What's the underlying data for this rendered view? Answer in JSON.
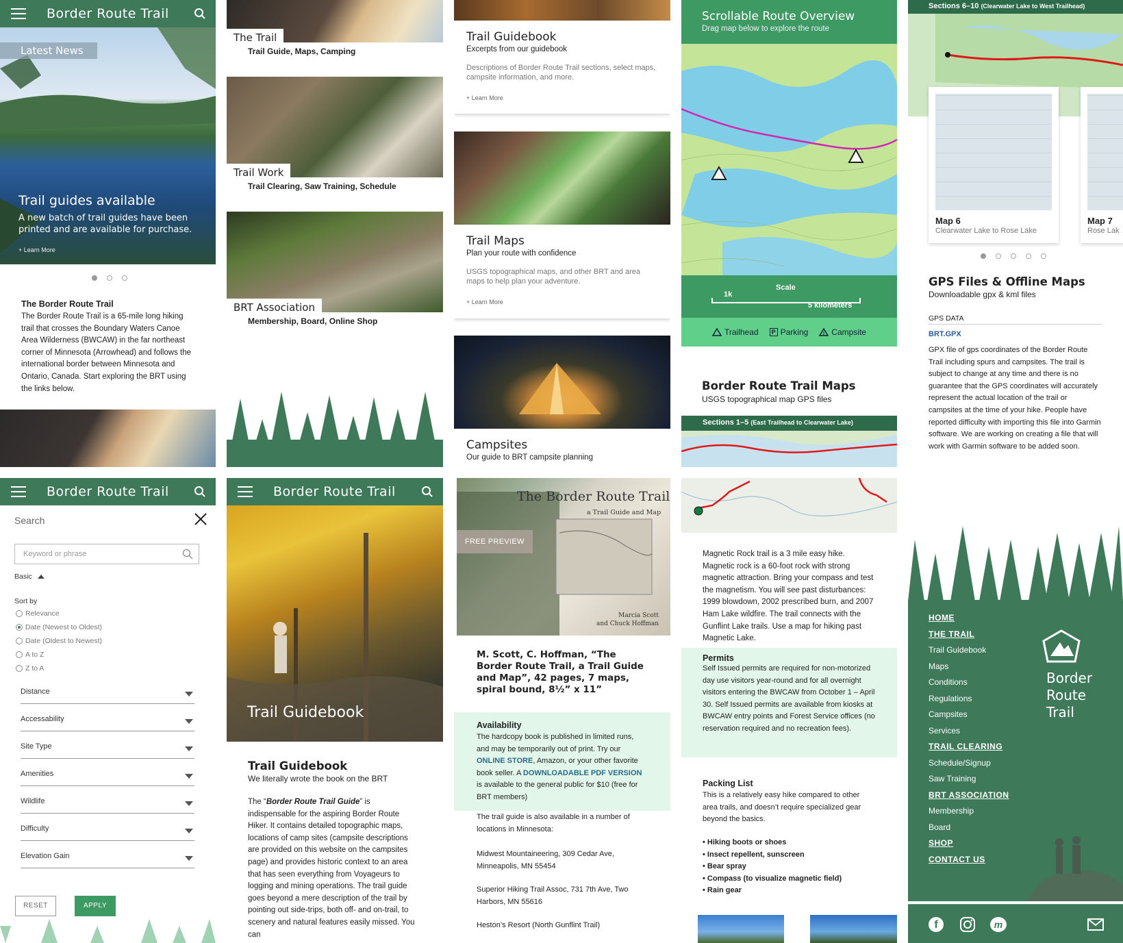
{
  "app": {
    "title": "Border Route Trail"
  },
  "home": {
    "news_label": "Latest News",
    "hero_title": "Trail guides available",
    "hero_text": "A new batch of trail guides have been printed and are available for purchase.",
    "hero_more": "+ Learn More",
    "intro_title": "The Border Route Trail",
    "intro_text": "The Border Route Trail is a 65-mile long hiking trail that crosses the Boundary Waters Canoe Area Wilderness (BWCAW) in the far northeast corner of Minnesota (Arrowhead) and follows the international border between Minnesota and Ontario, Canada. Start exploring the BRT using the links below."
  },
  "sections": [
    {
      "title": "The Trail",
      "subtitle": "Trail Guide, Maps, Camping"
    },
    {
      "title": "Trail Work",
      "subtitle": "Trail Clearing, Saw Training, Schedule"
    },
    {
      "title": "BRT Association",
      "subtitle": "Membership, Board, Online Shop"
    }
  ],
  "cards": {
    "guidebook": {
      "title": "Trail Guidebook",
      "subtitle": "Excerpts from our guidebook",
      "desc": "Descriptions of Border Route Trail sections, select maps, campsite information, and more.",
      "more": "+ Learn More"
    },
    "maps": {
      "title": "Trail Maps",
      "subtitle": "Plan your route with confidence",
      "desc": "USGS topographical maps, and other BRT and area maps to help plan your adventure.",
      "more": "+ Learn More"
    },
    "campsites": {
      "title": "Campsites",
      "subtitle": "Our guide to BRT campsite planning"
    }
  },
  "overview": {
    "title": "Scrollable Route Overview",
    "subtitle": "Drag map below to explore the route",
    "scale_label": "Scale",
    "scale_1k": "1k",
    "scale_5k": "5 kilometers",
    "legend": {
      "trailhead": "Trailhead",
      "parking": "Parking",
      "campsite": "Campsite"
    },
    "maps_title": "Border Route Trail Maps",
    "maps_subtitle": "USGS topographical map GPS files",
    "sections_label": "Sections 1–5",
    "sections_detail": "(East Trailhead to Clearwater Lake)"
  },
  "gps": {
    "sections_label": "Sections 6–10",
    "sections_detail": "(Clearwater Lake to West Trailhead)",
    "map_a_title": "Map 6",
    "map_a_sub": "Clearwater Lake to Rose Lake",
    "map_b_title": "Map 7",
    "map_b_sub": "Rose Lak",
    "title": "GPS Files & Offline Maps",
    "subtitle": "Downloadable gpx & kml files",
    "data_label": "GPS DATA",
    "file": "BRT.GPX",
    "desc": "GPX file of gps coordinates of the Border Route Trail including spurs and campsites. The trail is subject to change at any time and there is no guarantee that the GPS coordinates will accurately represent the actual location of the trail or campsites at the time of your hike. People have reported difficulty with importing this file into Garmin software. We are working on creating a file that will work with Garmin software to be added soon."
  },
  "search": {
    "label": "Search",
    "placeholder": "Keyword or phrase",
    "basic": "Basic",
    "sort_by": "Sort by",
    "options": [
      "Relevance",
      "Date (Newest to Oldest)",
      "Date (Oldest to Newest)",
      "A to Z",
      "Z to A"
    ],
    "filters": [
      "Distance",
      "Accessability",
      "Site Type",
      "Amenities",
      "Wildlife",
      "Difficulty",
      "Elevation Gain"
    ],
    "reset": "RESET",
    "apply": "APPLY"
  },
  "guidebook_page": {
    "hero": "Trail Guidebook",
    "title": "Trail Guidebook",
    "subtitle": "We literally wrote the book on the BRT",
    "text_a": "The “",
    "text_em": "Border Route Trail Guide",
    "text_b": "” is indispensable for the aspiring Border Route Hiker. It contains detailed topographic maps, locations of camp sites (campsite descriptions are provided on this website on the campsites page) and provides historic context to an area that has seen everything from Voyageurs to logging and mining operations. The trail guide goes beyond a mere description of the trail by pointing out side-trips, both off- and on-trail, to scenery and natural features easily missed. You can"
  },
  "book": {
    "cover_title": "The Border Route Trail",
    "cover_sub": "a Trail Guide and Map",
    "cover_authors_1": "Marcia Scott",
    "cover_authors_2": "and Chuck Hoffman",
    "preview": "FREE PREVIEW",
    "citation": "M. Scott, C. Hoffman, “The Border Route Trail, a Trail Guide and Map”, 42 pages, 7 maps, spiral bound, 8½” x 11”",
    "avail_title": "Availability",
    "avail_1": "The hardcopy book is published in limited runs, and may be temporarily out of print. Try our ",
    "avail_link1": "ONLINE STORE",
    "avail_2": ", Amazon, or your other favorite book seller. A ",
    "avail_link2": "DOWNLOADABLE PDF VERSION",
    "avail_3": " is available to the general public for $10 (free for BRT members)",
    "locations_intro": "The trail guide is also available in a number of locations in Minnesota:",
    "locations": [
      "Midwest Mountaineering, 309 Cedar Ave, Minneapolis, MN 55454",
      "Superior Hiking Trail Assoc, 731 7th Ave, Two Harbors, MN 55616",
      "Heston’s Resort (North Gunflint Trail)"
    ]
  },
  "magnetic": {
    "desc": "Magnetic Rock trail is a 3 mile easy hike. Magnetic rock is a 60-foot rock with strong magnetic attraction. Bring your compass and test the magnetism. You will see past disturbances: 1999 blowdown, 2002 prescribed burn, and 2007 Ham Lake wildfire. The trail connects with the Gunflint Lake trails. Use a map for hiking past Magnetic Lake.",
    "permits_title": "Permits",
    "permits": "Self Issued permits are required for non-motorized day use visitors year-round and for all overnight visitors entering the BWCAW from October 1 – April 30. Self Issued permits are available from kiosks at BWCAW entry points and Forest Service offices (no reservation required and no recreation fees).",
    "packing_title": "Packing List",
    "packing": "This is a relatively easy hike compared to other area trails, and doesn’t require specialized gear beyond the basics.",
    "items": [
      "• Hiking boots or shoes",
      "• Insect repellent, sunscreen",
      "• Bear spray",
      "• Compass (to visualize magnetic field)",
      "• Rain gear"
    ]
  },
  "footer": {
    "nav": [
      {
        "label": "HOME",
        "heading": true
      },
      {
        "label": "THE TRAIL",
        "heading": true
      },
      {
        "label": "Trail Guidebook"
      },
      {
        "label": "Maps"
      },
      {
        "label": "Conditions"
      },
      {
        "label": "Regulations"
      },
      {
        "label": "Campsites"
      },
      {
        "label": "Services"
      },
      {
        "label": "TRAIL CLEARING",
        "heading": true
      },
      {
        "label": "Schedule/Signup"
      },
      {
        "label": "Saw Training"
      },
      {
        "label": "BRT ASSOCIATION",
        "heading": true
      },
      {
        "label": "Membership"
      },
      {
        "label": "Board"
      },
      {
        "label": "SHOP",
        "heading": true
      },
      {
        "label": "CONTACT US",
        "heading": true
      }
    ],
    "logo_1": "Border",
    "logo_2": "Route",
    "logo_3": "Trail"
  },
  "colors": {
    "brand": "#3e7a5a",
    "light_green": "#5fcf8a",
    "mint": "#e3f6ea",
    "link": "#2a6a8a"
  }
}
